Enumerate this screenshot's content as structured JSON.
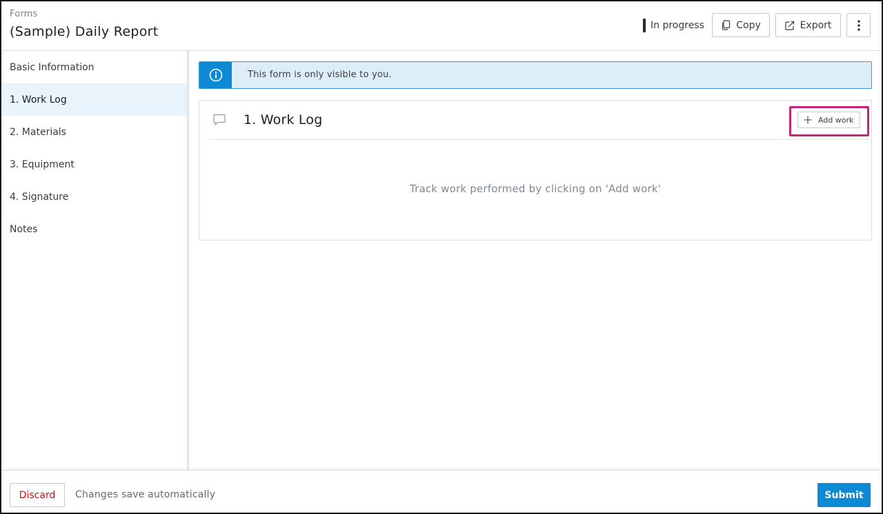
{
  "header": {
    "breadcrumb": "Forms",
    "title": "(Sample) Daily Report",
    "status": "In progress",
    "copy_label": "Copy",
    "export_label": "Export"
  },
  "sidebar": {
    "items": [
      {
        "label": "Basic Information",
        "active": false
      },
      {
        "label": "1. Work Log",
        "active": true
      },
      {
        "label": "2. Materials",
        "active": false
      },
      {
        "label": "3. Equipment",
        "active": false
      },
      {
        "label": "4. Signature",
        "active": false
      },
      {
        "label": "Notes",
        "active": false
      }
    ]
  },
  "banner": {
    "text": "This form is only visible to you.",
    "icon": "info-icon"
  },
  "section": {
    "title": "1. Work Log",
    "add_label": "Add work",
    "empty_text": "Track work performed by clicking on 'Add work'"
  },
  "footer": {
    "discard_label": "Discard",
    "autosave_text": "Changes save automatically",
    "submit_label": "Submit"
  },
  "colors": {
    "accent": "#0c8bd4",
    "active_nav_bg": "#e9f3fb",
    "banner_bg": "#ddeef9",
    "discard_text": "#c4161c",
    "highlight": "#c2247a"
  }
}
